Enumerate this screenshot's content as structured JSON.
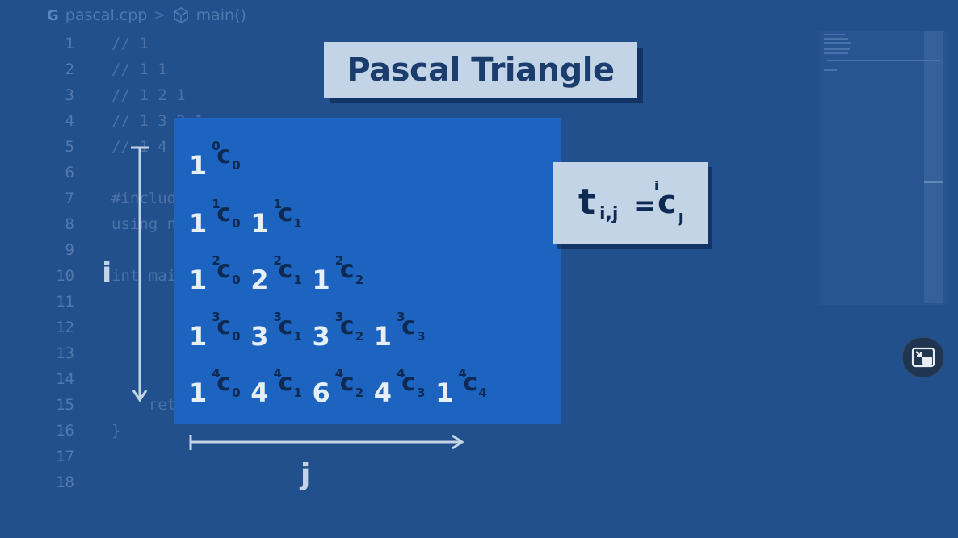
{
  "breadcrumb": {
    "file": "pascal.cpp",
    "symbol": "main()",
    "file_icon": "cpp-icon",
    "symbol_icon": "cube-icon"
  },
  "editor": {
    "lines": [
      {
        "n": "1",
        "code": "// 1"
      },
      {
        "n": "2",
        "code": "// 1 1"
      },
      {
        "n": "3",
        "code": "// 1 2 1"
      },
      {
        "n": "4",
        "code": "// 1 3 3 1"
      },
      {
        "n": "5",
        "code": "// 1 4 6 4 1"
      },
      {
        "n": "6",
        "code": ""
      },
      {
        "n": "7",
        "code": "#include<iostream>"
      },
      {
        "n": "8",
        "code": "using namespace std;"
      },
      {
        "n": "9",
        "code": ""
      },
      {
        "n": "10",
        "code": "int main(){"
      },
      {
        "n": "11",
        "code": ""
      },
      {
        "n": "12",
        "code": ""
      },
      {
        "n": "13",
        "code": ""
      },
      {
        "n": "14",
        "code": ""
      },
      {
        "n": "15",
        "code": "    return 0;"
      },
      {
        "n": "16",
        "code": "}"
      },
      {
        "n": "17",
        "code": ""
      },
      {
        "n": "18",
        "code": ""
      }
    ]
  },
  "overlay": {
    "title": "Pascal Triangle",
    "c_letter": "c",
    "rows": [
      {
        "terms": [
          {
            "coef": "1",
            "n": "0",
            "k": "0"
          }
        ]
      },
      {
        "terms": [
          {
            "coef": "1",
            "n": "1",
            "k": "0"
          },
          {
            "coef": "1",
            "n": "1",
            "k": "1"
          }
        ]
      },
      {
        "terms": [
          {
            "coef": "1",
            "n": "2",
            "k": "0"
          },
          {
            "coef": "2",
            "n": "2",
            "k": "1"
          },
          {
            "coef": "1",
            "n": "2",
            "k": "2"
          }
        ]
      },
      {
        "terms": [
          {
            "coef": "1",
            "n": "3",
            "k": "0"
          },
          {
            "coef": "3",
            "n": "3",
            "k": "1"
          },
          {
            "coef": "3",
            "n": "3",
            "k": "2"
          },
          {
            "coef": "1",
            "n": "3",
            "k": "3"
          }
        ]
      },
      {
        "terms": [
          {
            "coef": "1",
            "n": "4",
            "k": "0"
          },
          {
            "coef": "4",
            "n": "4",
            "k": "1"
          },
          {
            "coef": "6",
            "n": "4",
            "k": "2"
          },
          {
            "coef": "4",
            "n": "4",
            "k": "3"
          },
          {
            "coef": "1",
            "n": "4",
            "k": "4"
          }
        ]
      }
    ],
    "axis_i": "i",
    "axis_j": "j",
    "formula": {
      "t": "t",
      "sub": "i,j",
      "equals": "=",
      "c": "c",
      "sup": "i",
      "csub": "j"
    }
  },
  "pip_icon": "picture-in-picture-icon"
}
